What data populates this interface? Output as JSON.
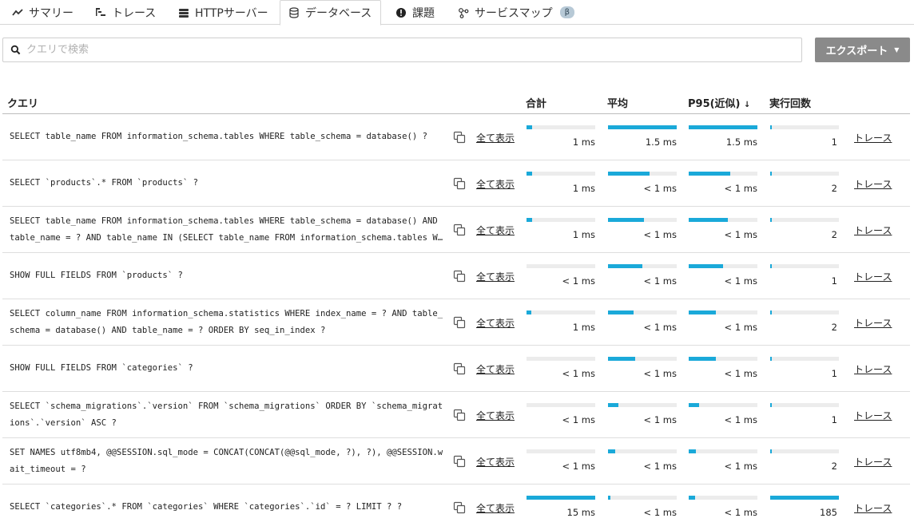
{
  "tabs": [
    {
      "label": "サマリー",
      "icon": "trend-line-icon",
      "active": false
    },
    {
      "label": "トレース",
      "icon": "trace-icon",
      "active": false
    },
    {
      "label": "HTTPサーバー",
      "icon": "server-icon",
      "active": false
    },
    {
      "label": "データベース",
      "icon": "database-icon",
      "active": true
    },
    {
      "label": "課題",
      "icon": "alert-icon",
      "active": false
    },
    {
      "label": "サービスマップ",
      "icon": "service-map-icon",
      "active": false,
      "badge": "β"
    }
  ],
  "search": {
    "placeholder": "クエリで検索",
    "value": ""
  },
  "export": {
    "label": "エクスポート",
    "caret": "▼"
  },
  "table": {
    "headers": {
      "query": "クエリ",
      "total": "合計",
      "avg": "平均",
      "p95": "P95(近似)",
      "p95_sort": "↓",
      "count": "実行回数"
    },
    "show_all_label": "全て表示",
    "trace_label": "トレース",
    "rows": [
      {
        "query": "SELECT table_name FROM information_schema.tables WHERE table_schema = database() ?",
        "total": "1 ms",
        "total_pct": 0.08,
        "avg": "1.5 ms",
        "avg_pct": 1.0,
        "p95": "1.5 ms",
        "p95_pct": 1.0,
        "count": "1",
        "count_pct": 0.01
      },
      {
        "query": "SELECT `products`.* FROM `products` ?",
        "total": "1 ms",
        "total_pct": 0.08,
        "avg": "< 1 ms",
        "avg_pct": 0.6,
        "p95": "< 1 ms",
        "p95_pct": 0.6,
        "count": "2",
        "count_pct": 0.01
      },
      {
        "query": "SELECT table_name FROM information_schema.tables WHERE table_schema = database() AND table_name = ? AND table_name IN (SELECT table_name FROM information_schema.tables WHERE table_schema = database())",
        "total": "1 ms",
        "total_pct": 0.08,
        "avg": "< 1 ms",
        "avg_pct": 0.52,
        "p95": "< 1 ms",
        "p95_pct": 0.57,
        "count": "2",
        "count_pct": 0.01
      },
      {
        "query": "SHOW FULL FIELDS FROM `products` ?",
        "total": "< 1 ms",
        "total_pct": 0.0,
        "avg": "< 1 ms",
        "avg_pct": 0.5,
        "p95": "< 1 ms",
        "p95_pct": 0.5,
        "count": "1",
        "count_pct": 0.01
      },
      {
        "query": "SELECT column_name FROM information_schema.statistics WHERE index_name = ? AND table_schema = database() AND table_name = ? ORDER BY seq_in_index ?",
        "total": "1 ms",
        "total_pct": 0.07,
        "avg": "< 1 ms",
        "avg_pct": 0.37,
        "p95": "< 1 ms",
        "p95_pct": 0.4,
        "count": "2",
        "count_pct": 0.01
      },
      {
        "query": "SHOW FULL FIELDS FROM `categories` ?",
        "total": "< 1 ms",
        "total_pct": 0.0,
        "avg": "< 1 ms",
        "avg_pct": 0.39,
        "p95": "< 1 ms",
        "p95_pct": 0.39,
        "count": "1",
        "count_pct": 0.01
      },
      {
        "query": "SELECT `schema_migrations`.`version` FROM `schema_migrations` ORDER BY `schema_migrations`.`version` ASC ?",
        "total": "< 1 ms",
        "total_pct": 0.0,
        "avg": "< 1 ms",
        "avg_pct": 0.15,
        "p95": "< 1 ms",
        "p95_pct": 0.15,
        "count": "1",
        "count_pct": 0.01
      },
      {
        "query": "SET NAMES utf8mb4, @@SESSION.sql_mode = CONCAT(CONCAT(@@sql_mode, ?), ?), @@SESSION.wait_timeout = ?",
        "total": "< 1 ms",
        "total_pct": 0.0,
        "avg": "< 1 ms",
        "avg_pct": 0.1,
        "p95": "< 1 ms",
        "p95_pct": 0.11,
        "count": "2",
        "count_pct": 0.01
      },
      {
        "query": "SELECT `categories`.* FROM `categories` WHERE `categories`.`id` = ? LIMIT ? ?",
        "total": "15 ms",
        "total_pct": 1.0,
        "avg": "< 1 ms",
        "avg_pct": 0.04,
        "p95": "< 1 ms",
        "p95_pct": 0.09,
        "count": "185",
        "count_pct": 1.0
      }
    ]
  },
  "colors": {
    "bar_fill": "#1aa9d9",
    "bar_track": "#ececec",
    "export_bg": "#8a8a8a"
  }
}
